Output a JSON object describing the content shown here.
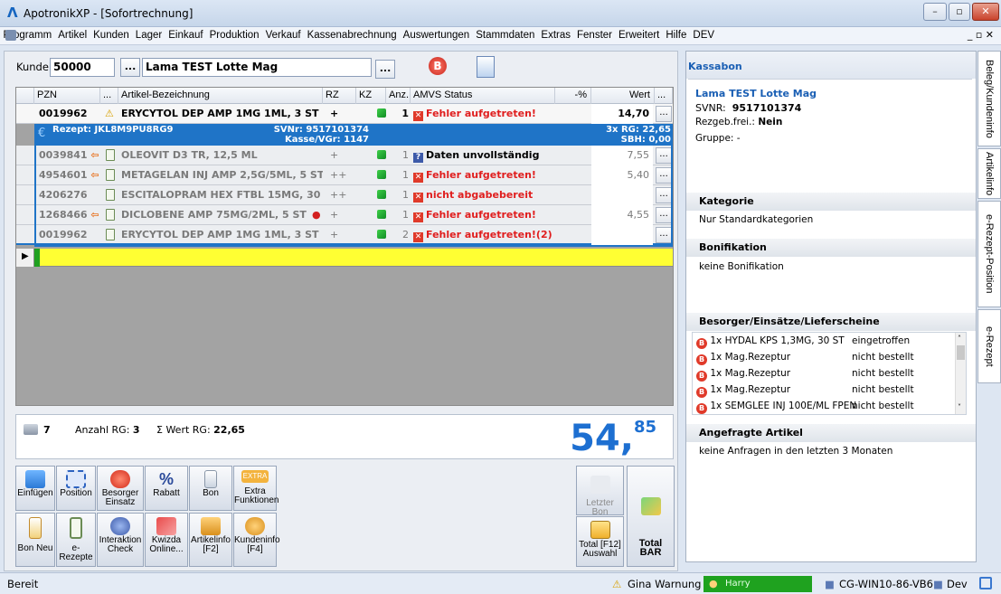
{
  "window": {
    "title": "ApotronikXP  - [Sofortrechnung]"
  },
  "menu": [
    "Programm",
    "Artikel",
    "Kunden",
    "Lager",
    "Einkauf",
    "Produktion",
    "Verkauf",
    "Kassenabrechnung",
    "Auswertungen",
    "Stammdaten",
    "Extras",
    "Fenster",
    "Erweitert",
    "Hilfe",
    "DEV"
  ],
  "kunde": {
    "label": "Kunde:",
    "number": "50000",
    "name": "Lama TEST Lotte Mag",
    "dots": "..."
  },
  "grid": {
    "headers": {
      "pzn": "PZN",
      "dots": "...",
      "bez": "Artikel-Bezeichnung",
      "rz": "RZ",
      "kz": "KZ",
      "anz": "Anz.",
      "amvs": "AMVS Status",
      "pct": "-%",
      "wert": "Wert",
      "more": "..."
    },
    "row0": {
      "pzn": "0019962",
      "bez": "ERYCYTOL DEP AMP 1MG 1ML, 3 ST",
      "rz": "+",
      "anz": "1",
      "status": "Fehler aufgetreten!",
      "wert": "14,70"
    },
    "rezept": {
      "id": "Rezept: JKL8M9PU8RG9",
      "svnr": "SVNr: 9517101374",
      "kasse": "Kasse/VGr: 1147",
      "rg": "3x RG: 22,65",
      "sbh": "SBH: 0,00"
    },
    "rows": [
      {
        "pzn": "0039841",
        "bez": "OLEOVIT D3 TR, 12,5 ML",
        "rz": "+",
        "anz": "1",
        "status": "Daten unvollständig",
        "wert": "7,55"
      },
      {
        "pzn": "4954601",
        "bez": "METAGELAN INJ AMP 2,5G/5ML, 5 ST",
        "rz": "++",
        "anz": "1",
        "status": "Fehler aufgetreten!",
        "wert": "5,40"
      },
      {
        "pzn": "4206276",
        "bez": "ESCITALOPRAM HEX FTBL 15MG, 30 ST",
        "rz": "++",
        "anz": "1",
        "status": "nicht abgabebereit",
        "wert": ""
      },
      {
        "pzn": "1268466",
        "bez": "DICLOBENE AMP 75MG/2ML, 5 ST",
        "rz": "+",
        "anz": "1",
        "status": "Fehler aufgetreten!",
        "wert": "4,55"
      },
      {
        "pzn": "0019962",
        "bez": "ERYCYTOL DEP AMP 1MG 1ML, 3 ST",
        "rz": "+",
        "anz": "2",
        "status": "Fehler aufgetreten!(2)",
        "wert": ""
      }
    ]
  },
  "summary": {
    "count": "7",
    "anzahl_label": "Anzahl RG:",
    "anzahl": "3",
    "sum_label": "Σ Wert RG:",
    "sum": "22,65",
    "total_main": "54",
    "total_cents": "85",
    "total_comma": ","
  },
  "buttons": {
    "einfuegen": "Einfügen",
    "position": "Position",
    "besorger": "Besorger Einsatz",
    "rabatt": "Rabatt",
    "bon": "Bon",
    "extra": "Extra Funktionen",
    "extra_icon": "EXTRA",
    "bonneu": "Bon Neu",
    "erezepte": "e-Rezepte",
    "interaktion": "Interaktion Check",
    "kwizda": "Kwizda Online...",
    "artikelinfo": "Artikelinfo [F2]",
    "kundeninfo": "Kundeninfo [F4]",
    "letzterbon": "Letzter Bon",
    "totalauswahl": "Total [F12] Auswahl",
    "totalbar": "Total BAR"
  },
  "right": {
    "kassabon": "Kassabon",
    "name": "Lama TEST Lotte Mag",
    "svnr_label": "SVNR:",
    "svnr": "9517101374",
    "rezgeb_label": "Rezgeb.frei.:",
    "rezgeb": "Nein",
    "gruppe": "Gruppe: -",
    "kategorie_title": "Kategorie",
    "kategorie": "Nur Standardkategorien",
    "bonifikation_title": "Bonifikation",
    "bonifikation": "keine Bonifikation",
    "besorger_title": "Besorger/Einsätze/Lieferscheine",
    "besorger": [
      {
        "item": "1x HYDAL KPS 1,3MG, 30 ST",
        "status": "eingetroffen"
      },
      {
        "item": "1x Mag.Rezeptur",
        "status": "nicht bestellt"
      },
      {
        "item": "1x Mag.Rezeptur",
        "status": "nicht bestellt"
      },
      {
        "item": "1x Mag.Rezeptur",
        "status": "nicht bestellt"
      },
      {
        "item": "1x SEMGLEE INJ 100E/ML FPEN",
        "status": "nicht bestellt"
      }
    ],
    "angefragt_title": "Angefragte Artikel",
    "angefragt": "keine Anfragen in den letzten 3 Monaten"
  },
  "vtabs": [
    "Beleg/Kundeninfo",
    "Artikelinfo",
    "e-Rezept-Position",
    "e-Rezept"
  ],
  "status": {
    "bereit": "Bereit",
    "warnung": "Gina Warnung",
    "user": "Harry",
    "pc": "CG-WIN10-86-VB6",
    "dev": "Dev"
  }
}
